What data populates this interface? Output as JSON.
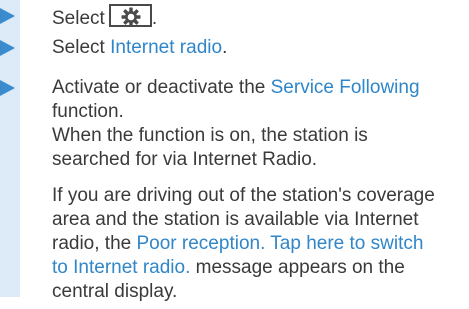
{
  "steps": [
    {
      "prefix": "Select",
      "icon": "settings-gear-icon",
      "suffix": "."
    },
    {
      "prefix": "Select ",
      "link": "Internet radio",
      "suffix": "."
    },
    {
      "prefix": "Activate or deactivate the ",
      "link": "Service Following",
      "line2": "function.",
      "note1": "When the function is on, the station is",
      "note2": "searched for via Internet Radio."
    }
  ],
  "paragraph": {
    "l1": "If you are driving out of the station's coverage",
    "l2": "area and the station is available via Internet",
    "l3a": "radio, the ",
    "l3b": "Poor reception. Tap here to switch",
    "l4a": "to Internet radio.",
    "l4b": " message appears on the",
    "l5": "central display."
  },
  "colors": {
    "accent": "#2f86c9",
    "marker": "#3b8bcf",
    "sidebar": "#dcebf7",
    "text": "#3a3a3a"
  }
}
